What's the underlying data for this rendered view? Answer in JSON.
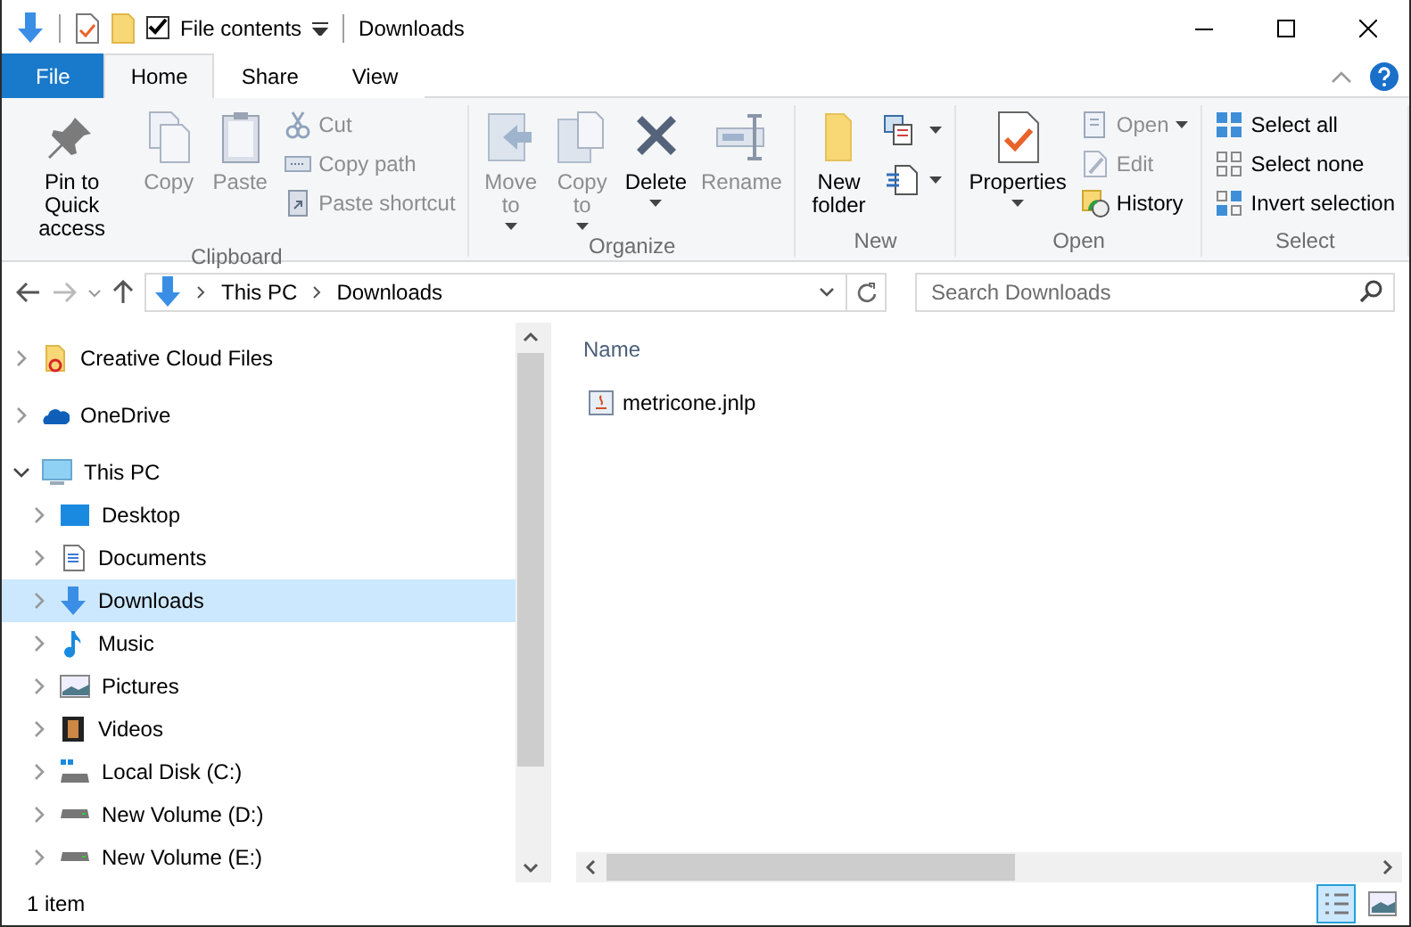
{
  "window": {
    "title": "Downloads"
  },
  "quick_access_toolbar": {
    "checkbox_label": "File contents",
    "checked": true
  },
  "ribbon_tabs": [
    {
      "label": "File",
      "kind": "file",
      "selected": false
    },
    {
      "label": "Home",
      "kind": "tab",
      "selected": true
    },
    {
      "label": "Share",
      "kind": "tab",
      "selected": false
    },
    {
      "label": "View",
      "kind": "tab",
      "selected": false
    }
  ],
  "ribbon_groups": [
    {
      "label": "Clipboard",
      "commands": [
        {
          "label": "Pin to Quick access",
          "kind": "large",
          "disabled": false,
          "dropdown": false
        },
        {
          "label": "Copy",
          "kind": "large",
          "disabled": true,
          "dropdown": false
        },
        {
          "label": "Paste",
          "kind": "large",
          "disabled": true,
          "dropdown": false
        },
        {
          "label": "Cut",
          "kind": "small",
          "disabled": true,
          "dropdown": false
        },
        {
          "label": "Copy path",
          "kind": "small",
          "disabled": true,
          "dropdown": false
        },
        {
          "label": "Paste shortcut",
          "kind": "small",
          "disabled": true,
          "dropdown": false
        }
      ]
    },
    {
      "label": "Organize",
      "commands": [
        {
          "label": "Move to",
          "kind": "large",
          "disabled": true,
          "dropdown": true
        },
        {
          "label": "Copy to",
          "kind": "large",
          "disabled": true,
          "dropdown": true
        },
        {
          "label": "Delete",
          "kind": "large",
          "disabled": false,
          "dropdown": true
        },
        {
          "label": "Rename",
          "kind": "large",
          "disabled": true,
          "dropdown": false
        }
      ]
    },
    {
      "label": "New",
      "commands": [
        {
          "label": "New folder",
          "kind": "large",
          "disabled": false,
          "dropdown": false
        },
        {
          "kind": "icon",
          "disabled": false,
          "dropdown": true
        },
        {
          "kind": "icon",
          "disabled": false,
          "dropdown": true
        }
      ]
    },
    {
      "label": "Open",
      "commands": [
        {
          "label": "Properties",
          "kind": "large",
          "disabled": false,
          "dropdown": true
        },
        {
          "label": "Open",
          "kind": "small",
          "disabled": true,
          "dropdown": true
        },
        {
          "label": "Edit",
          "kind": "small",
          "disabled": true,
          "dropdown": false
        },
        {
          "label": "History",
          "kind": "small",
          "disabled": false,
          "dropdown": false
        }
      ]
    },
    {
      "label": "Select",
      "commands": [
        {
          "label": "Select all",
          "kind": "small",
          "disabled": false,
          "dropdown": false
        },
        {
          "label": "Select none",
          "kind": "small",
          "disabled": false,
          "dropdown": false
        },
        {
          "label": "Invert selection",
          "kind": "small",
          "disabled": false,
          "dropdown": false
        }
      ]
    }
  ],
  "address_bar": {
    "breadcrumbs": [
      "This PC",
      "Downloads"
    ]
  },
  "search": {
    "placeholder": "Search Downloads"
  },
  "nav_pane": {
    "items": [
      {
        "label": "Creative Cloud Files",
        "expanded": false,
        "selected": false
      },
      {
        "label": "OneDrive",
        "expanded": false,
        "selected": false
      },
      {
        "label": "This PC",
        "expanded": true,
        "selected": false,
        "children": [
          {
            "label": "Desktop",
            "expanded": false,
            "selected": false
          },
          {
            "label": "Documents",
            "expanded": false,
            "selected": false
          },
          {
            "label": "Downloads",
            "expanded": false,
            "selected": true
          },
          {
            "label": "Music",
            "expanded": false,
            "selected": false
          },
          {
            "label": "Pictures",
            "expanded": false,
            "selected": false
          },
          {
            "label": "Videos",
            "expanded": false,
            "selected": false
          },
          {
            "label": "Local Disk (C:)",
            "expanded": false,
            "selected": false
          },
          {
            "label": "New Volume (D:)",
            "expanded": false,
            "selected": false
          },
          {
            "label": "New Volume (E:)",
            "expanded": false,
            "selected": false
          }
        ]
      }
    ]
  },
  "file_list": {
    "columns": [
      "Name"
    ],
    "files": [
      {
        "name": "metricone.jnlp"
      }
    ]
  },
  "status_bar": {
    "text": "1 item",
    "view_buttons": [
      {
        "selected": true
      },
      {
        "selected": false
      }
    ]
  }
}
